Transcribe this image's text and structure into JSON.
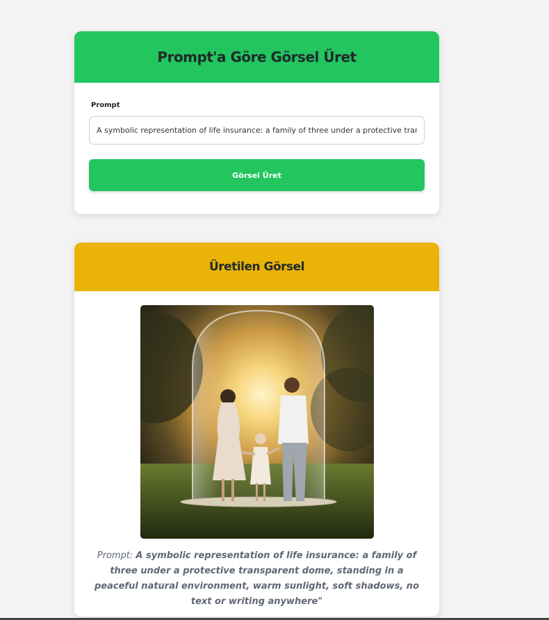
{
  "generator_card": {
    "title": "Prompt'a Göre Görsel Üret",
    "prompt_label": "Prompt",
    "prompt_value": "A symbolic representation of life insurance: a family of three under a protective transparent dome, standing in a peaceful natural environment, warm sunlight, soft shadows, no text or writing anywhere",
    "button_label": "Görsel Üret",
    "accent_color": "#22c55e"
  },
  "result_card": {
    "title": "Üretilen Görsel",
    "header_color": "#eab308",
    "caption_prefix": "Prompt:",
    "caption_text": "A symbolic representation of life insurance: a family of three under a protective transparent dome, standing in a peaceful natural environment, warm sunlight, soft shadows, no text or writing anywhere\""
  }
}
